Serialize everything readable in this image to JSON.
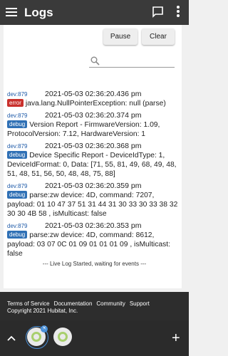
{
  "appbar": {
    "title": "Logs"
  },
  "toolbar": {
    "pause_label": "Pause",
    "clear_label": "Clear"
  },
  "search": {
    "placeholder": "",
    "value": ""
  },
  "entries": [
    {
      "device": "dev:879",
      "time": "2021-05-03 02:36:20.436 pm",
      "level": "error",
      "message": "java.lang.NullPointerException: null (parse)"
    },
    {
      "device": "dev:879",
      "time": "2021-05-03 02:36:20.374 pm",
      "level": "debug",
      "message": "Version Report - FirmwareVersion: 1.09, ProtocolVersion: 7.12, HardwareVersion: 1"
    },
    {
      "device": "dev:879",
      "time": "2021-05-03 02:36:20.368 pm",
      "level": "debug",
      "message": "Device Specific Report - DeviceIdType: 1, DeviceIdFormat: 0, Data: [71, 55, 81, 49, 68, 49, 48, 51, 48, 51, 56, 50, 48, 48, 75, 88]"
    },
    {
      "device": "dev:879",
      "time": "2021-05-03 02:36:20.359 pm",
      "level": "debug",
      "message": "parse:zw device: 4D, command: 7207, payload: 01 10 47 37 51 31 44 31 30 33 30 33 38 32 30 30 4B 58 , isMulticast: false"
    },
    {
      "device": "dev:879",
      "time": "2021-05-03 02:36:20.353 pm",
      "level": "debug",
      "message": "parse:zw device: 4D, command: 8612, payload: 03 07 0C 01 09 01 01 01 09 , isMulticast: false"
    }
  ],
  "log_start": "--- Live Log Started, waiting for events ---",
  "footer": {
    "links": [
      "Terms of Service",
      "Documentation",
      "Community",
      "Support"
    ],
    "copyright": "Copyright 2021 Hubitat, Inc."
  },
  "colors": {
    "appbar": "#3a3a3a",
    "error": "#c9302c",
    "debug": "#2f70b5",
    "device_link": "#1e5aa8"
  },
  "icons": {
    "menu": "hamburger-icon",
    "chat": "chat-bubble-icon",
    "more": "more-vert-icon",
    "search": "search-icon",
    "up": "chevron-up-icon",
    "add": "plus-icon"
  }
}
